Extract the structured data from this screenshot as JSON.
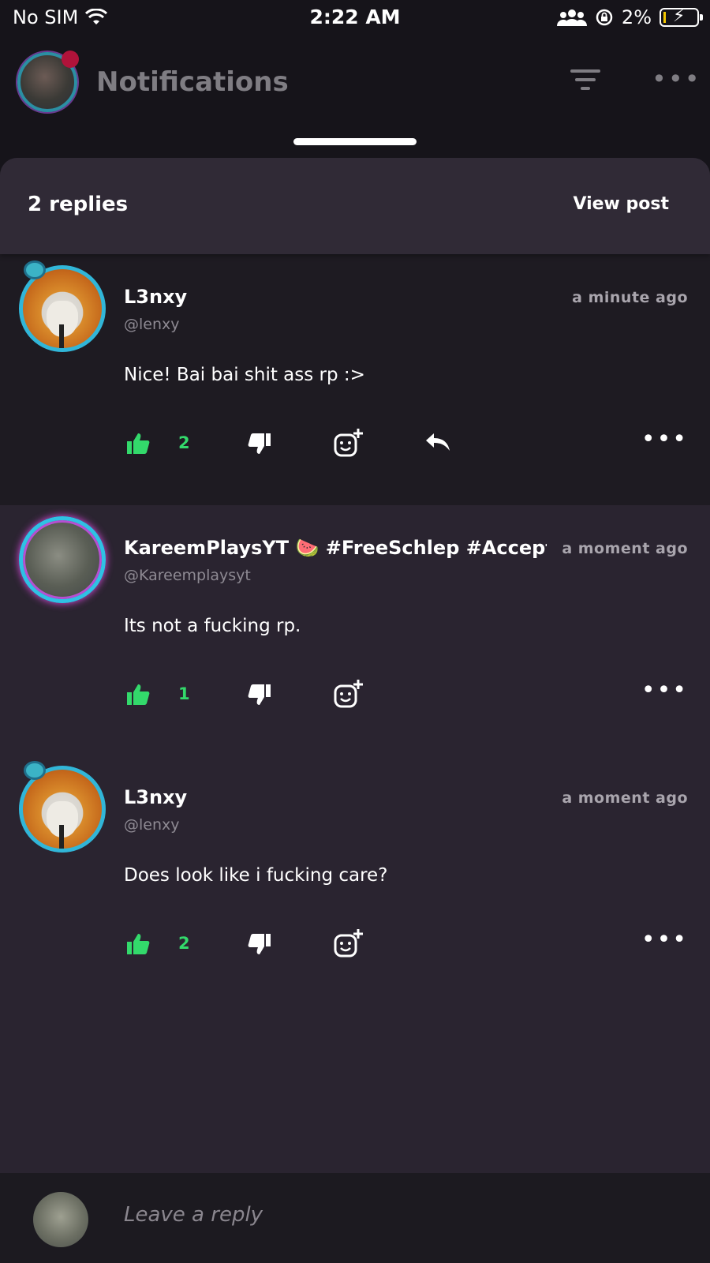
{
  "status_bar": {
    "carrier": "No SIM",
    "time": "2:22 AM",
    "battery": "2%"
  },
  "header": {
    "title": "Notifications"
  },
  "sheet": {
    "replies_count": "2 replies",
    "view_post": "View post"
  },
  "comments": [
    {
      "username": "L3nxy",
      "handle": "@lenxy",
      "time": "a minute ago",
      "text": "Nice! Bai bai shit ass rp :>",
      "likes": "2"
    },
    {
      "username": "KareemPlaysYT 🍉 #FreeSchlep #Acceptth",
      "handle": "@Kareemplaysyt",
      "time": "a moment ago",
      "text": "Its not a fucking rp.",
      "likes": "1"
    },
    {
      "username": "L3nxy",
      "handle": "@lenxy",
      "time": "a moment ago",
      "text": "Does look like i fucking care?",
      "likes": "2"
    }
  ],
  "footer": {
    "placeholder": "Leave a reply"
  },
  "colors": {
    "like_green": "#33d96b",
    "sheet_bg": "#2a2430",
    "highlight_bg": "#1e1b22"
  }
}
